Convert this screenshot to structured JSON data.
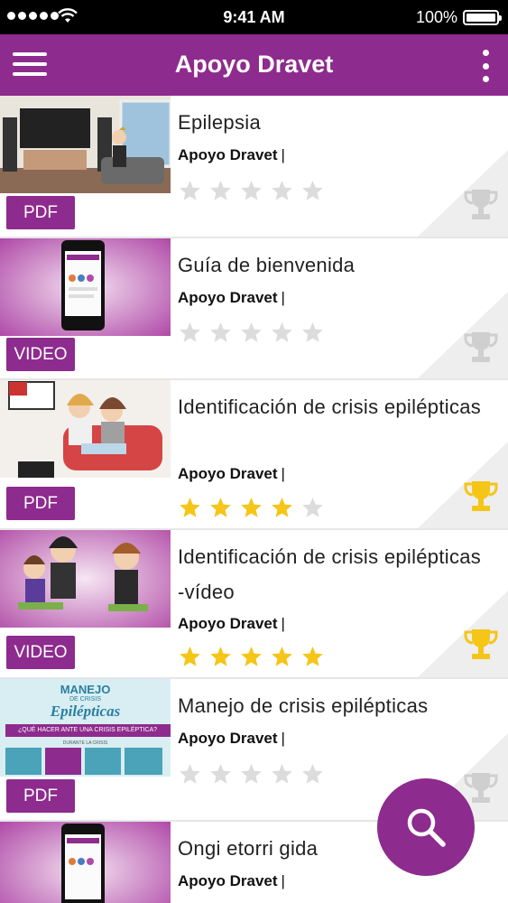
{
  "status_bar": {
    "time": "9:41 AM",
    "battery": "100%"
  },
  "app_bar": {
    "title": "Apoyo Dravet",
    "menu_icon": "hamburger-menu-icon",
    "more_icon": "more-vertical-icon"
  },
  "colors": {
    "brand": "#8e2b8e",
    "star_active": "#f5c518",
    "star_inactive": "#dcdcdc",
    "trophy_active": "#f5c518",
    "trophy_inactive": "#cfcfcf"
  },
  "items": [
    {
      "title": "Epilepsia",
      "author": "Apoyo Dravet",
      "separator": "|",
      "type": "PDF",
      "rating": 0,
      "trophy": "inactive",
      "thumbnail": "cartoon-living-room"
    },
    {
      "title": "Guía de bienvenida",
      "author": "Apoyo Dravet",
      "separator": "|",
      "type": "VIDEO",
      "rating": 0,
      "trophy": "inactive",
      "thumbnail": "phone-app-screen"
    },
    {
      "title": "Identificación de crisis epilépticas",
      "author": "Apoyo Dravet",
      "separator": "|",
      "type": "PDF",
      "rating": 4,
      "trophy": "active",
      "thumbnail": "cartoon-couple-sofa"
    },
    {
      "title": "Identificación de crisis epilépticas -vídeo",
      "author": "Apoyo Dravet",
      "separator": "|",
      "type": "VIDEO",
      "rating": 5,
      "trophy": "active",
      "thumbnail": "cartoon-family"
    },
    {
      "title": "Manejo de crisis epilépticas",
      "author": "Apoyo Dravet",
      "separator": "|",
      "type": "PDF",
      "rating": 0,
      "trophy": "inactive",
      "thumbnail": "manejo-infographic",
      "thumb_text": {
        "line1": "MANEJO",
        "line2": "DE CRISIS",
        "line3": "Epilépticas",
        "question": "¿QUÉ HACER ANTE UNA CRISIS EPILÉPTICA?",
        "sub": "DURANTE LA CRISIS"
      }
    },
    {
      "title": "Ongi etorri gida",
      "author": "Apoyo Dravet",
      "separator": "|",
      "type": "",
      "rating": 0,
      "trophy": "none",
      "thumbnail": "phone-app-screen"
    }
  ],
  "fab": {
    "icon": "search-icon"
  }
}
